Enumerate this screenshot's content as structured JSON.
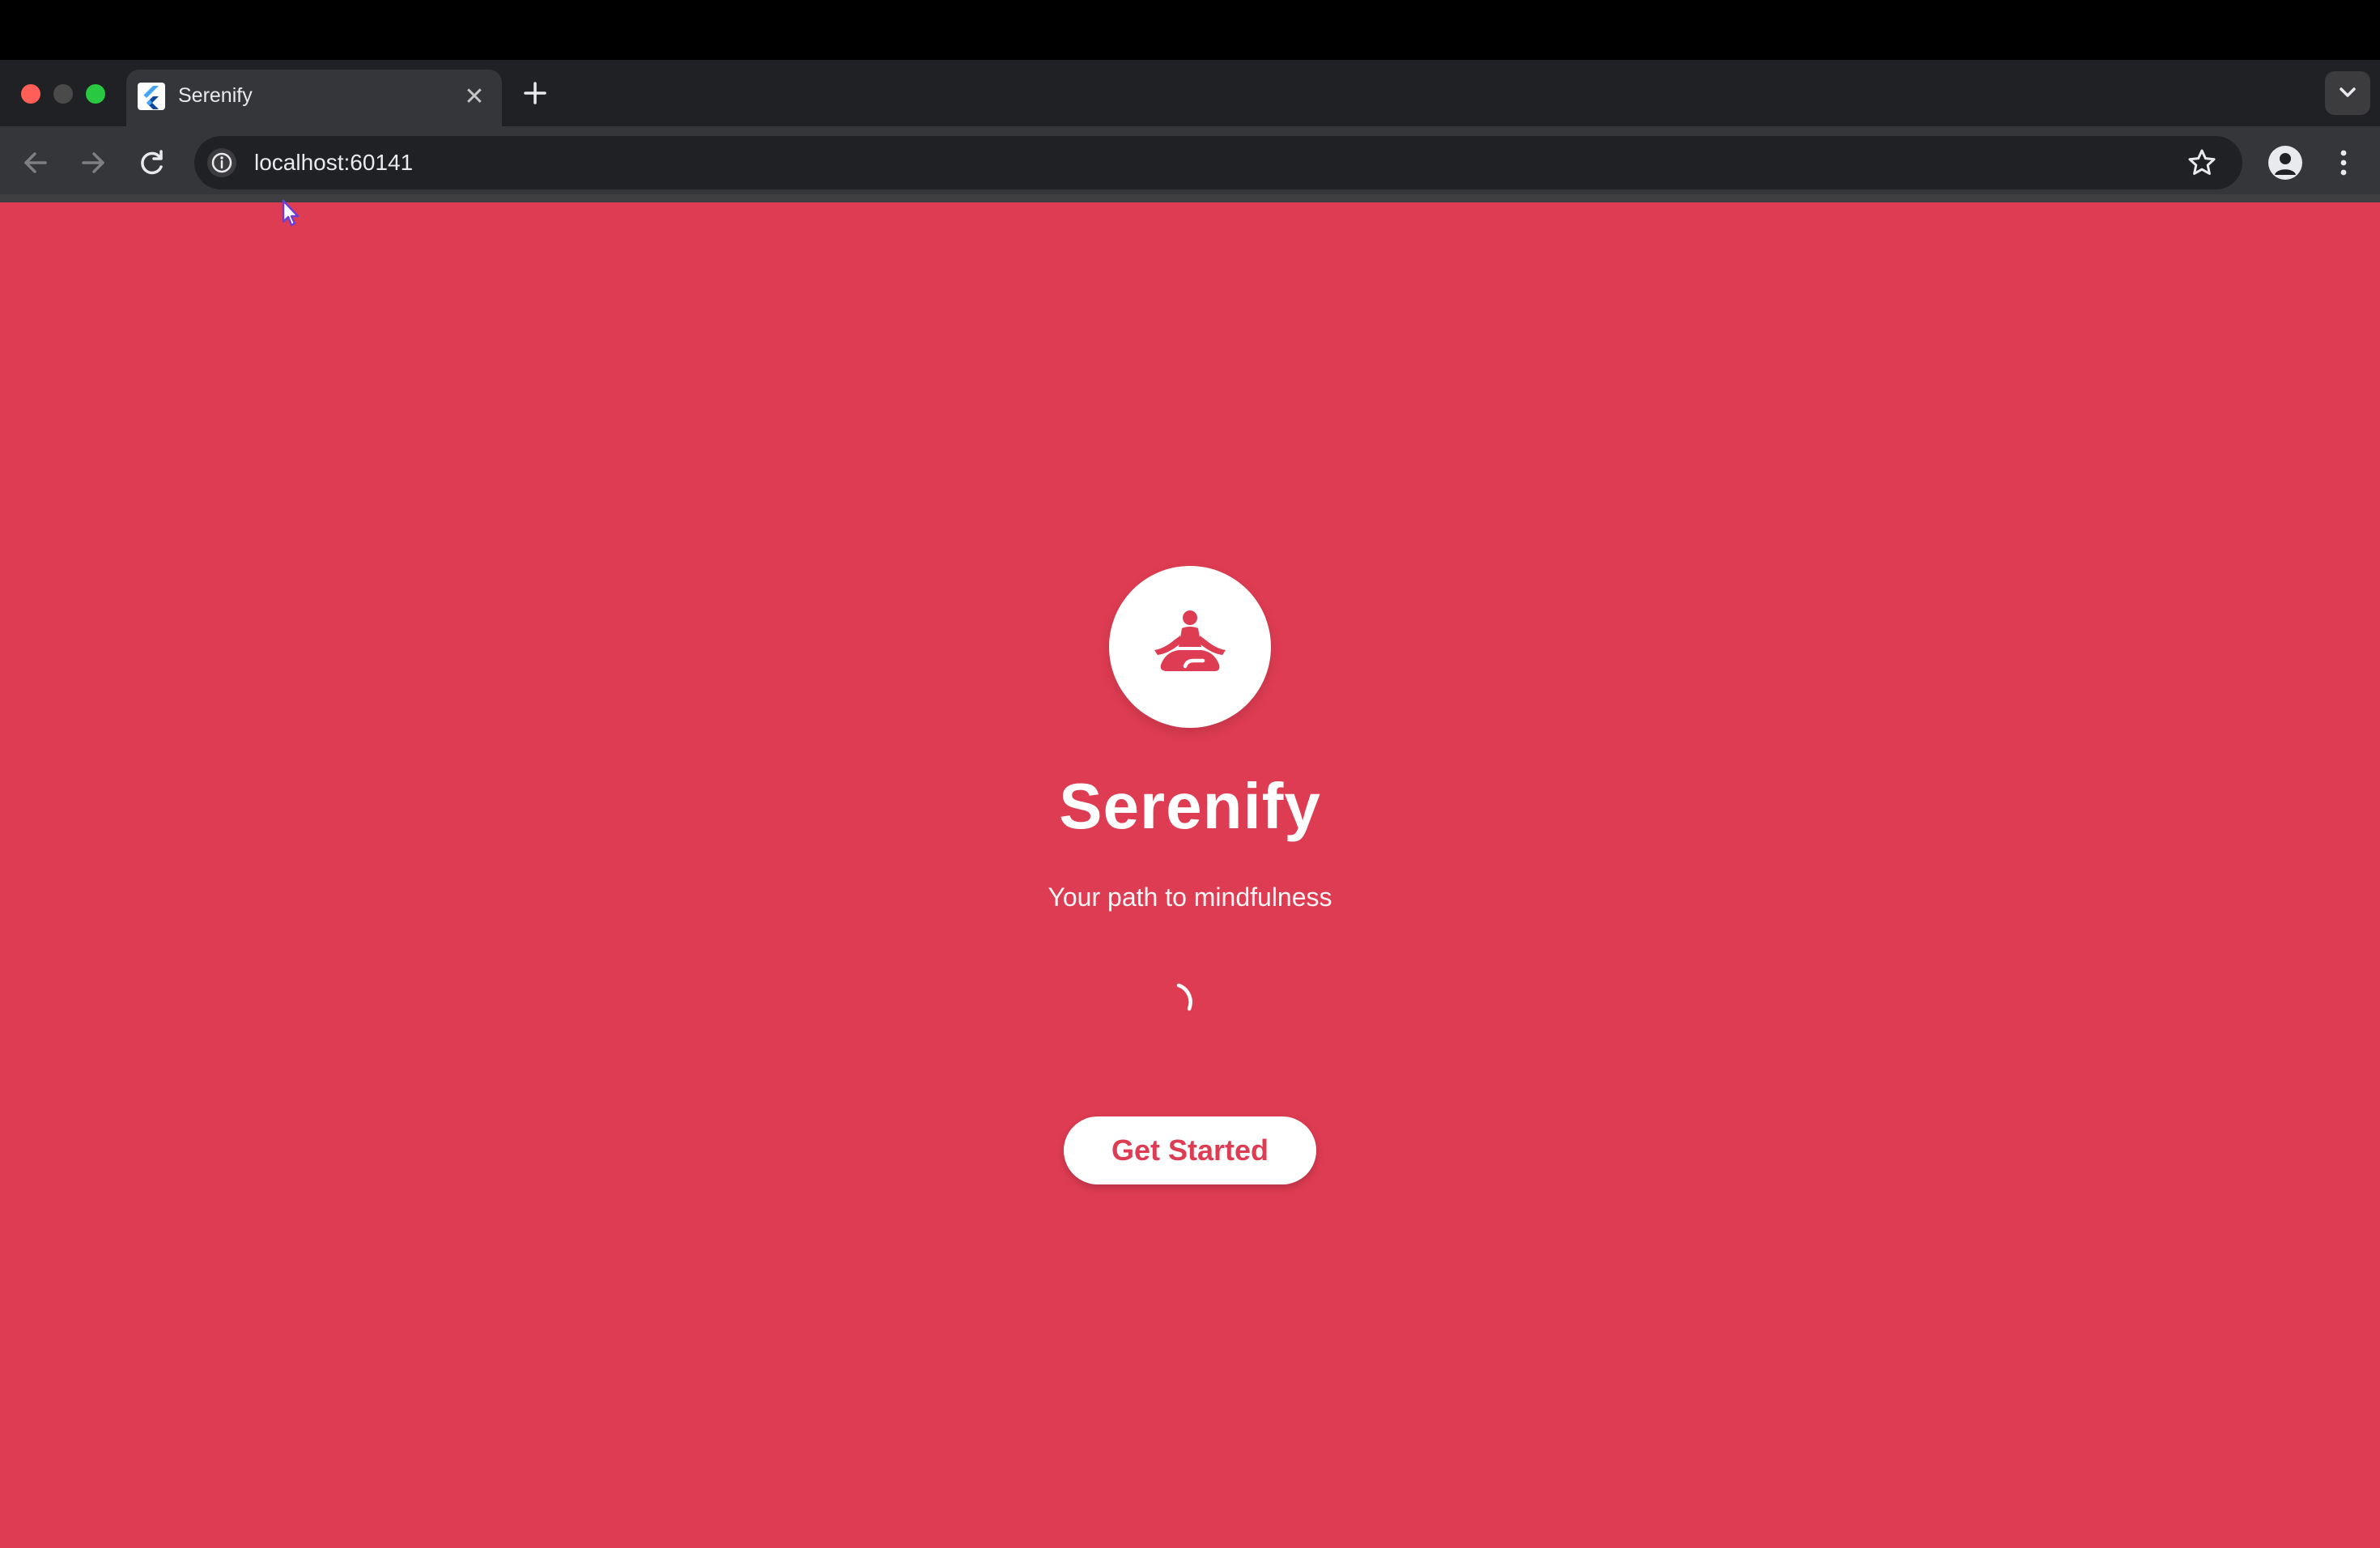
{
  "browser": {
    "tab": {
      "title": "Serenify",
      "close_glyph": "✕",
      "favicon": "flutter-icon"
    },
    "new_tab_icon": "plus-icon",
    "omnibox": {
      "url": "localhost:60141",
      "info_icon": "info-icon"
    },
    "nav_icons": [
      "back-arrow-icon",
      "forward-arrow-icon",
      "reload-icon"
    ],
    "right_icons": [
      "star-icon",
      "profile-icon",
      "kebab-menu-icon"
    ]
  },
  "app": {
    "logo_icon": "meditation-icon",
    "title": "Serenify",
    "tagline": "Your path to mindfulness",
    "cta_label": "Get Started",
    "loading_indicator": "spinner-icon"
  },
  "colors": {
    "brand": "#de3c52",
    "white": "#ffffff",
    "chrome_dark": "#202124",
    "chrome_toolbar": "#35363a"
  }
}
